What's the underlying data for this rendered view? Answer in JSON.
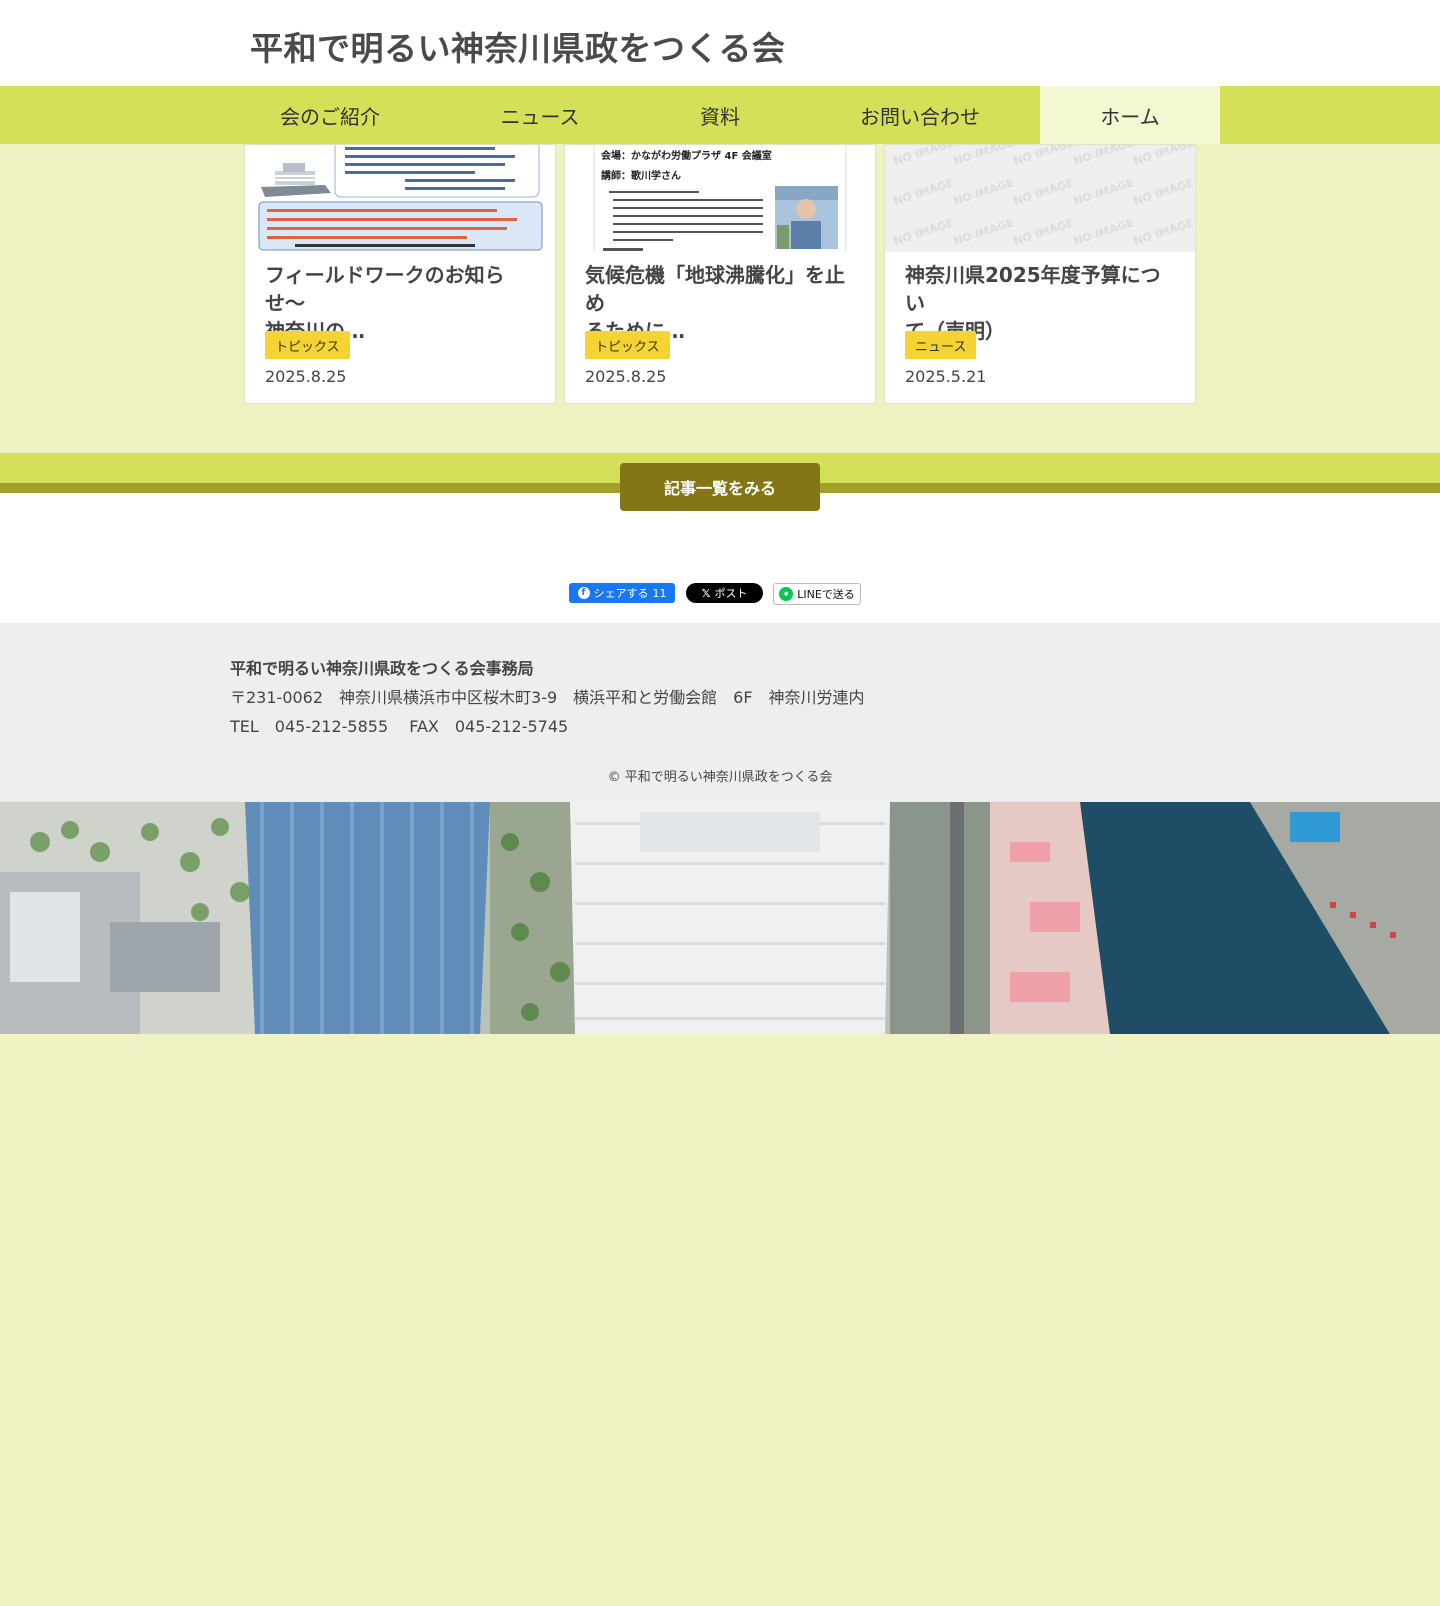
{
  "header": {
    "site_title": "平和で明るい神奈川県政をつくる会"
  },
  "nav": {
    "items": [
      {
        "label": "会のご紹介"
      },
      {
        "label": "ニュース"
      },
      {
        "label": "資料"
      },
      {
        "label": "お問い合わせ"
      },
      {
        "label": "ホーム",
        "active": true
      }
    ]
  },
  "cards": [
    {
      "title_line1": "フィールドワークのお知らせ〜",
      "title_line2": "神奈川の…",
      "category": "トピックス",
      "date": "2025.8.25"
    },
    {
      "title_line1": "気候危機「地球沸騰化」を止め",
      "title_line2": "るために…",
      "category": "トピックス",
      "date": "2025.8.25"
    },
    {
      "title_line1": "神奈川県2025年度予算につい",
      "title_line2": "て（声明）",
      "category": "ニュース",
      "date": "2025.5.21"
    }
  ],
  "thumb2_text": {
    "venue": "会場：かながわ労働プラザ 4F 会議室",
    "lecturer": "講師：歌川学さん"
  },
  "thumb3_text": "NO IMAGE",
  "more_button_label": "記事一覧をみる",
  "share": {
    "facebook_label": "シェアする",
    "facebook_count": "11",
    "x_label": "ポスト",
    "line_label": "LINEで送る"
  },
  "footer": {
    "org_name": "平和で明るい神奈川県政をつくる会事務局",
    "address": "〒231-0062　神奈川県横浜市中区桜木町3-9　横浜平和と労働会館　6F　神奈川労連内",
    "tel_fax": "TEL　045-212-5855　 FAX　045-212-5745",
    "copyright": "© 平和で明るい神奈川県政をつくる会"
  },
  "colors": {
    "nav_bg": "#d4e058",
    "nav_active_bg": "#f3f7d2",
    "page_bg": "#eff3c3",
    "badge": "#f5d431",
    "more_button": "#847617",
    "facebook": "#1877f2",
    "line": "#06c755"
  }
}
